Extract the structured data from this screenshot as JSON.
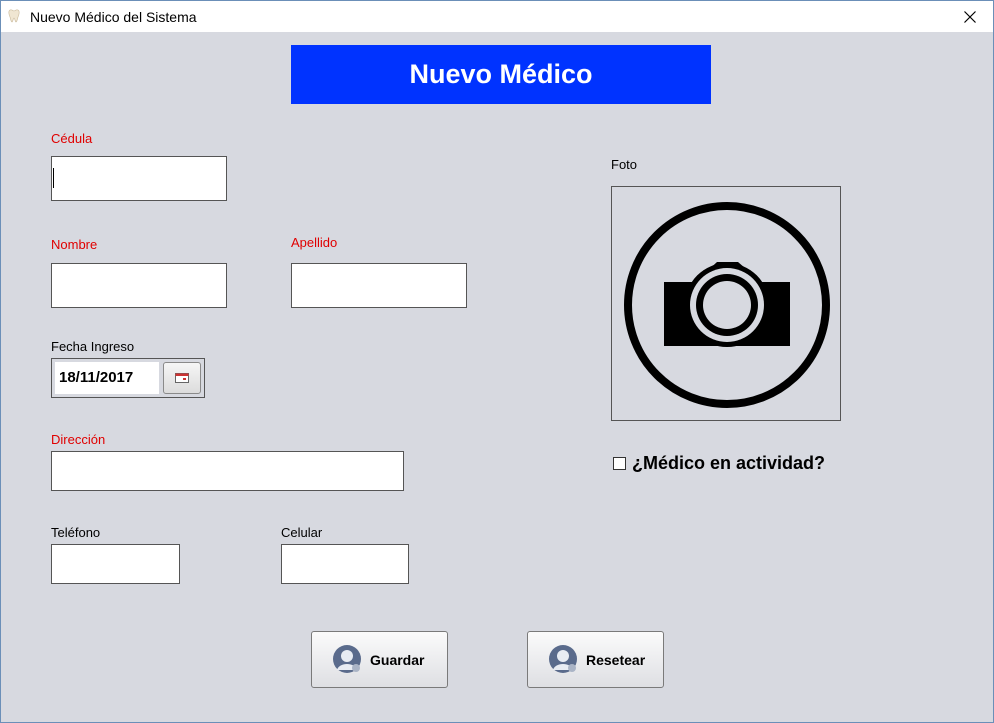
{
  "window": {
    "title": "Nuevo Médico del Sistema"
  },
  "header": {
    "title": "Nuevo Médico"
  },
  "form": {
    "cedula_label": "Cédula",
    "nombre_label": "Nombre",
    "apellido_label": "Apellido",
    "fecha_label": "Fecha Ingreso",
    "fecha_value": "18/11/2017",
    "direccion_label": "Dirección",
    "telefono_label": "Teléfono",
    "celular_label": "Celular",
    "foto_label": "Foto",
    "activo_label": "¿Médico en actividad?",
    "activo_checked": false
  },
  "buttons": {
    "guardar": "Guardar",
    "resetear": "Resetear"
  },
  "icons": {
    "app": "tooth-icon",
    "close": "close-icon",
    "calendar": "calendar-icon",
    "photo": "camera-icon",
    "user": "user-icon"
  },
  "colors": {
    "header_bg": "#0033ff",
    "required_label": "#e00000",
    "form_bg": "#d7d9e0"
  }
}
